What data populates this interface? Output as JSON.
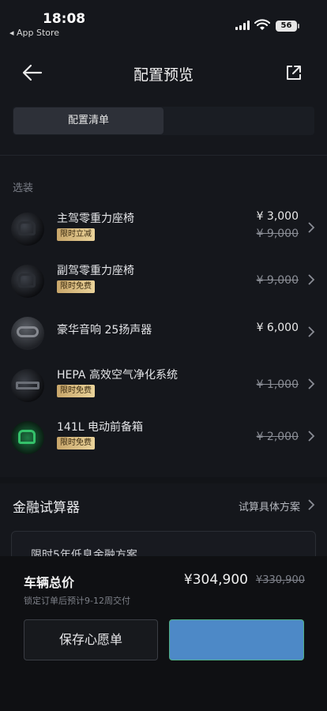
{
  "status_bar": {
    "time": "18:08",
    "back_app": "◂ App Store",
    "battery": "56"
  },
  "header": {
    "title": "配置预览",
    "back_icon": "arrow-left-icon",
    "share_icon": "share-icon"
  },
  "tabs": [
    {
      "label": "配置清单",
      "active": true
    },
    {
      "label": "",
      "active": false
    }
  ],
  "options_section": {
    "label": "选装",
    "items": [
      {
        "name": "主驾零重力座椅",
        "badge": "限时立减",
        "price": "¥ 3,000",
        "old_price": "¥ 9,000"
      },
      {
        "name": "副驾零重力座椅",
        "badge": "限时免费",
        "price": "",
        "old_price": "¥ 9,000"
      },
      {
        "name": "豪华音响 25扬声器",
        "badge": "",
        "price": "¥ 6,000",
        "old_price": ""
      },
      {
        "name": "HEPA 高效空气净化系统",
        "badge": "限时免费",
        "price": "",
        "old_price": "¥ 1,000"
      },
      {
        "name": "141L 电动前备箱",
        "badge": "限时免费",
        "price": "",
        "old_price": "¥ 2,000"
      }
    ]
  },
  "finance": {
    "title": "金融试算器",
    "link": "试算具体方案",
    "card_text": "限时5年低息金融方案"
  },
  "bottom_bar": {
    "total_label": "车辆总价",
    "delivery_note": "锁定订单后预计9-12周交付",
    "total_price": "¥304,900",
    "total_old_price": "¥330,900",
    "wishlist_button": "保存心愿单",
    "order_button": ""
  },
  "colors": {
    "background": "#15171c",
    "badge_gold": "#d9bb80",
    "primary_button": "#4d89c7"
  }
}
